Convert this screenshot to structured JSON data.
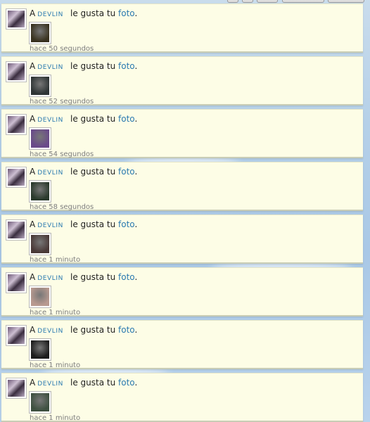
{
  "notifications": [
    {
      "prefix": "A",
      "user": "DEVLIN",
      "text": "le gusta tu",
      "link": "foto",
      "suffix": ".",
      "time": "hace 50 segundos",
      "thumb_color": "#3a3320"
    },
    {
      "prefix": "A",
      "user": "DEVLIN",
      "text": "le gusta tu",
      "link": "foto",
      "suffix": ".",
      "time": "hace 52 segundos",
      "thumb_color": "#2f3535"
    },
    {
      "prefix": "A",
      "user": "DEVLIN",
      "text": "le gusta tu",
      "link": "foto",
      "suffix": ".",
      "time": "hace 54 segundos",
      "thumb_color": "#6a4a8a"
    },
    {
      "prefix": "A",
      "user": "DEVLIN",
      "text": "le gusta tu",
      "link": "foto",
      "suffix": ".",
      "time": "hace 58 segundos",
      "thumb_color": "#2a3a2c"
    },
    {
      "prefix": "A",
      "user": "DEVLIN",
      "text": "le gusta tu",
      "link": "foto",
      "suffix": ".",
      "time": "hace 1 minuto",
      "thumb_color": "#4a3a38"
    },
    {
      "prefix": "A",
      "user": "DEVLIN",
      "text": "le gusta tu",
      "link": "foto",
      "suffix": ".",
      "time": "hace 1 minuto",
      "thumb_color": "#b89a90"
    },
    {
      "prefix": "A",
      "user": "DEVLIN",
      "text": "le gusta tu",
      "link": "foto",
      "suffix": ".",
      "time": "hace 1 minuto",
      "thumb_color": "#1c1c1c"
    },
    {
      "prefix": "A",
      "user": "DEVLIN",
      "text": "le gusta tu",
      "link": "foto",
      "suffix": ".",
      "time": "hace 1 minuto",
      "thumb_color": "#3e5040"
    }
  ]
}
